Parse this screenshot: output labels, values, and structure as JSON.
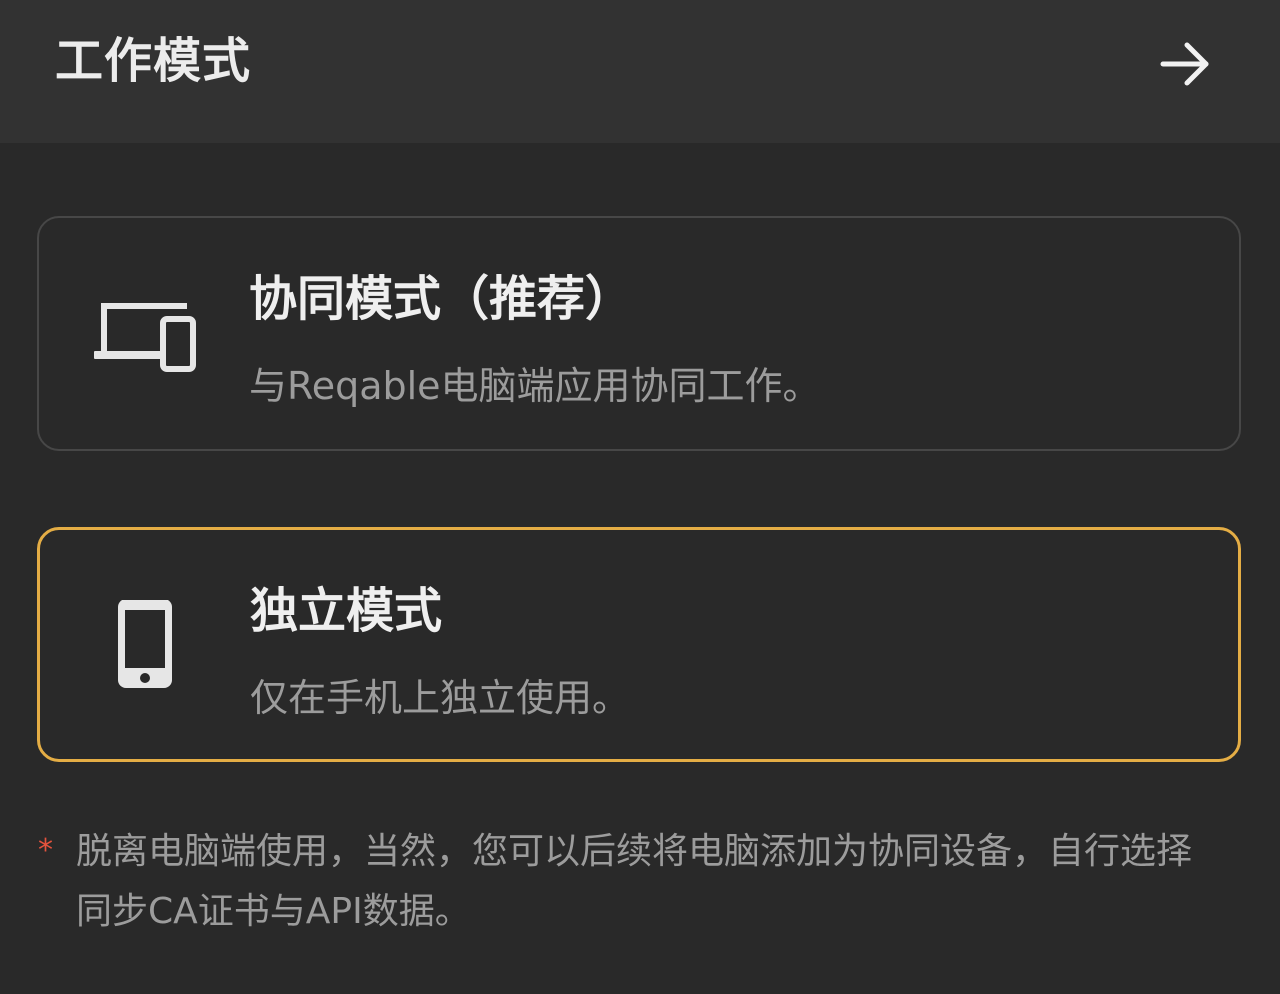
{
  "header": {
    "title": "工作模式",
    "next_icon": "arrow-right-icon"
  },
  "modes": {
    "collab": {
      "title": "协同模式（推荐）",
      "description": "与Reqable电脑端应用协同工作。",
      "icon": "devices-icon",
      "selected": false
    },
    "standalone": {
      "title": "独立模式",
      "description": "仅在手机上独立使用。",
      "icon": "phone-icon",
      "selected": true
    }
  },
  "note": {
    "marker": "*",
    "text": "脱离电脑端使用，当然，您可以后续将电脑添加为协同设备，自行选择同步CA证书与API数据。"
  },
  "colors": {
    "background": "#292929",
    "header_background": "#323232",
    "selected_border": "#e4ad45",
    "unselected_border": "#474747",
    "required_marker": "#e5533d"
  }
}
